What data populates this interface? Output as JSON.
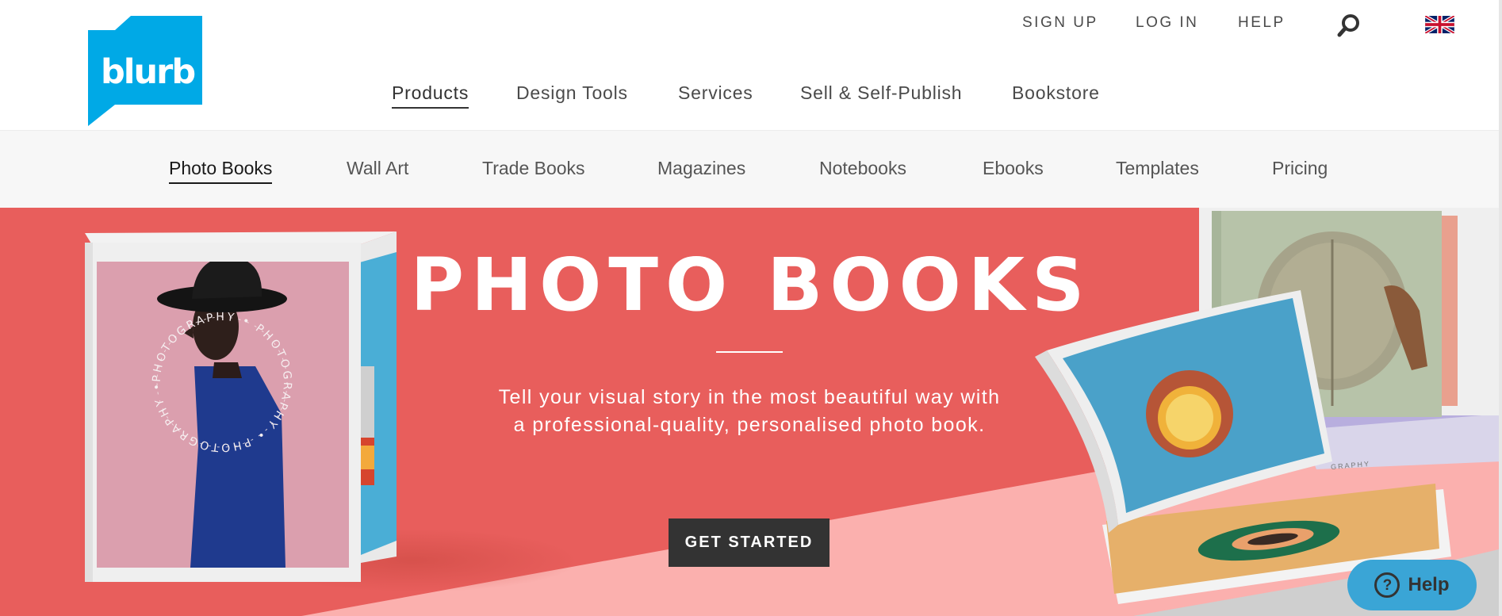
{
  "brand": {
    "logo_text": "blurb",
    "color": "#00a9e6"
  },
  "utility_nav": {
    "sign_up": "SIGN UP",
    "log_in": "LOG IN",
    "help": "HELP",
    "search_icon": "search-icon",
    "flag_icon": "uk-flag-icon"
  },
  "main_nav": {
    "items": [
      "Products",
      "Design Tools",
      "Services",
      "Sell & Self-Publish",
      "Bookstore"
    ],
    "active": "Products"
  },
  "sub_nav": {
    "items": [
      "Photo Books",
      "Wall Art",
      "Trade Books",
      "Magazines",
      "Notebooks",
      "Ebooks",
      "Templates",
      "Pricing"
    ],
    "active": "Photo Books"
  },
  "hero": {
    "title": "PHOTO BOOKS",
    "subtitle": "Tell your visual story in the most beautiful way with a professional-quality, personalised photo book.",
    "cta_label": "GET STARTED",
    "left_book_cover_text": "PHOTOGRAPHY • PHOTOGRAPHY • PHOTOGRAPHY •",
    "right_book_spine_text": "GRAPHY",
    "colors": {
      "hero_bg": "#e85e5c",
      "floor": "#fbb0ae",
      "cta_bg": "#333333"
    }
  },
  "help_widget": {
    "label": "Help",
    "icon": "question-circle-icon",
    "color": "#3aa5d6"
  }
}
